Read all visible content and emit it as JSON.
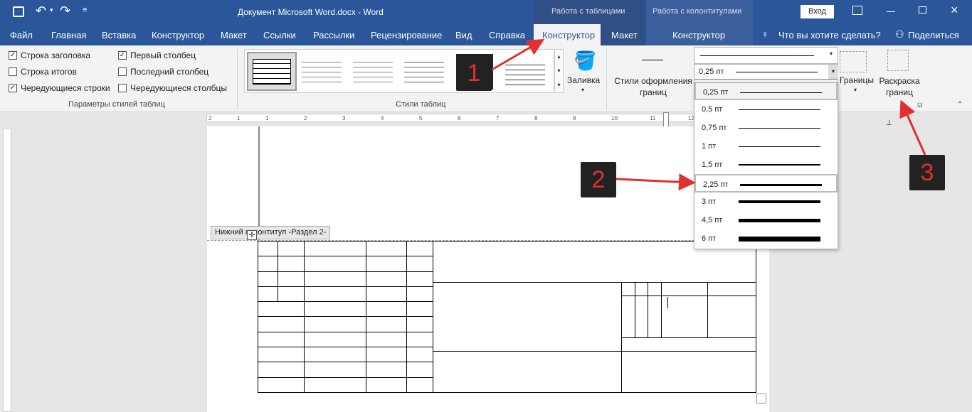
{
  "titlebar": {
    "doc_title": "Документ Microsoft Word.docx  -  Word",
    "context_tables": "Работа с таблицами",
    "context_headers": "Работа с колонтитулами",
    "login": "Вход"
  },
  "tabs": {
    "file": "Файл",
    "home": "Главная",
    "insert": "Вставка",
    "design": "Конструктор",
    "layout": "Макет",
    "references": "Ссылки",
    "mailings": "Рассылки",
    "review": "Рецензирование",
    "view": "Вид",
    "help": "Справка",
    "table_design": "Конструктор",
    "table_layout": "Макет",
    "hf_design": "Конструктор",
    "tell_me": "Что вы хотите сделать?",
    "share": "Поделиться"
  },
  "style_options": {
    "header_row": "Строка заголовка",
    "total_row": "Строка итогов",
    "banded_rows": "Чередующиеся строки",
    "first_column": "Первый столбец",
    "last_column": "Последний столбец",
    "banded_columns": "Чередующиеся столбцы",
    "checked": {
      "header_row": true,
      "total_row": false,
      "banded_rows": true,
      "first_column": true,
      "last_column": false,
      "banded_columns": false
    },
    "group_label": "Параметры стилей таблиц"
  },
  "table_styles": {
    "group_label": "Стили таблиц",
    "shading": "Заливка"
  },
  "borders": {
    "border_styles": "Стили оформления границ",
    "current_weight": "0,25 пт",
    "borders_btn": "Границы",
    "border_painter": "Раскраска границ"
  },
  "weights": [
    {
      "label": "0,25 пт",
      "thickness": 1,
      "selected": true
    },
    {
      "label": "0,5 пт",
      "thickness": 1,
      "selected": false
    },
    {
      "label": "0,75 пт",
      "thickness": 1,
      "selected": false
    },
    {
      "label": "1 пт",
      "thickness": 1,
      "selected": false
    },
    {
      "label": "1,5 пт",
      "thickness": 2,
      "selected": false
    },
    {
      "label": "2,25 пт",
      "thickness": 3,
      "selected": false,
      "highlighted": true
    },
    {
      "label": "3 пт",
      "thickness": 4,
      "selected": false
    },
    {
      "label": "4,5 пт",
      "thickness": 5,
      "selected": false
    },
    {
      "label": "6 пт",
      "thickness": 7,
      "selected": false
    }
  ],
  "footer_label": "Нижний колонтитул -Раздел 2-",
  "ruler_marks": [
    "2",
    "1",
    "1",
    "2",
    "3",
    "4",
    "5",
    "6",
    "7",
    "8",
    "9",
    "10",
    "11",
    "12"
  ],
  "annotations": {
    "a1": "1",
    "a2": "2",
    "a3": "3",
    "arrow_color": "#e03030"
  }
}
